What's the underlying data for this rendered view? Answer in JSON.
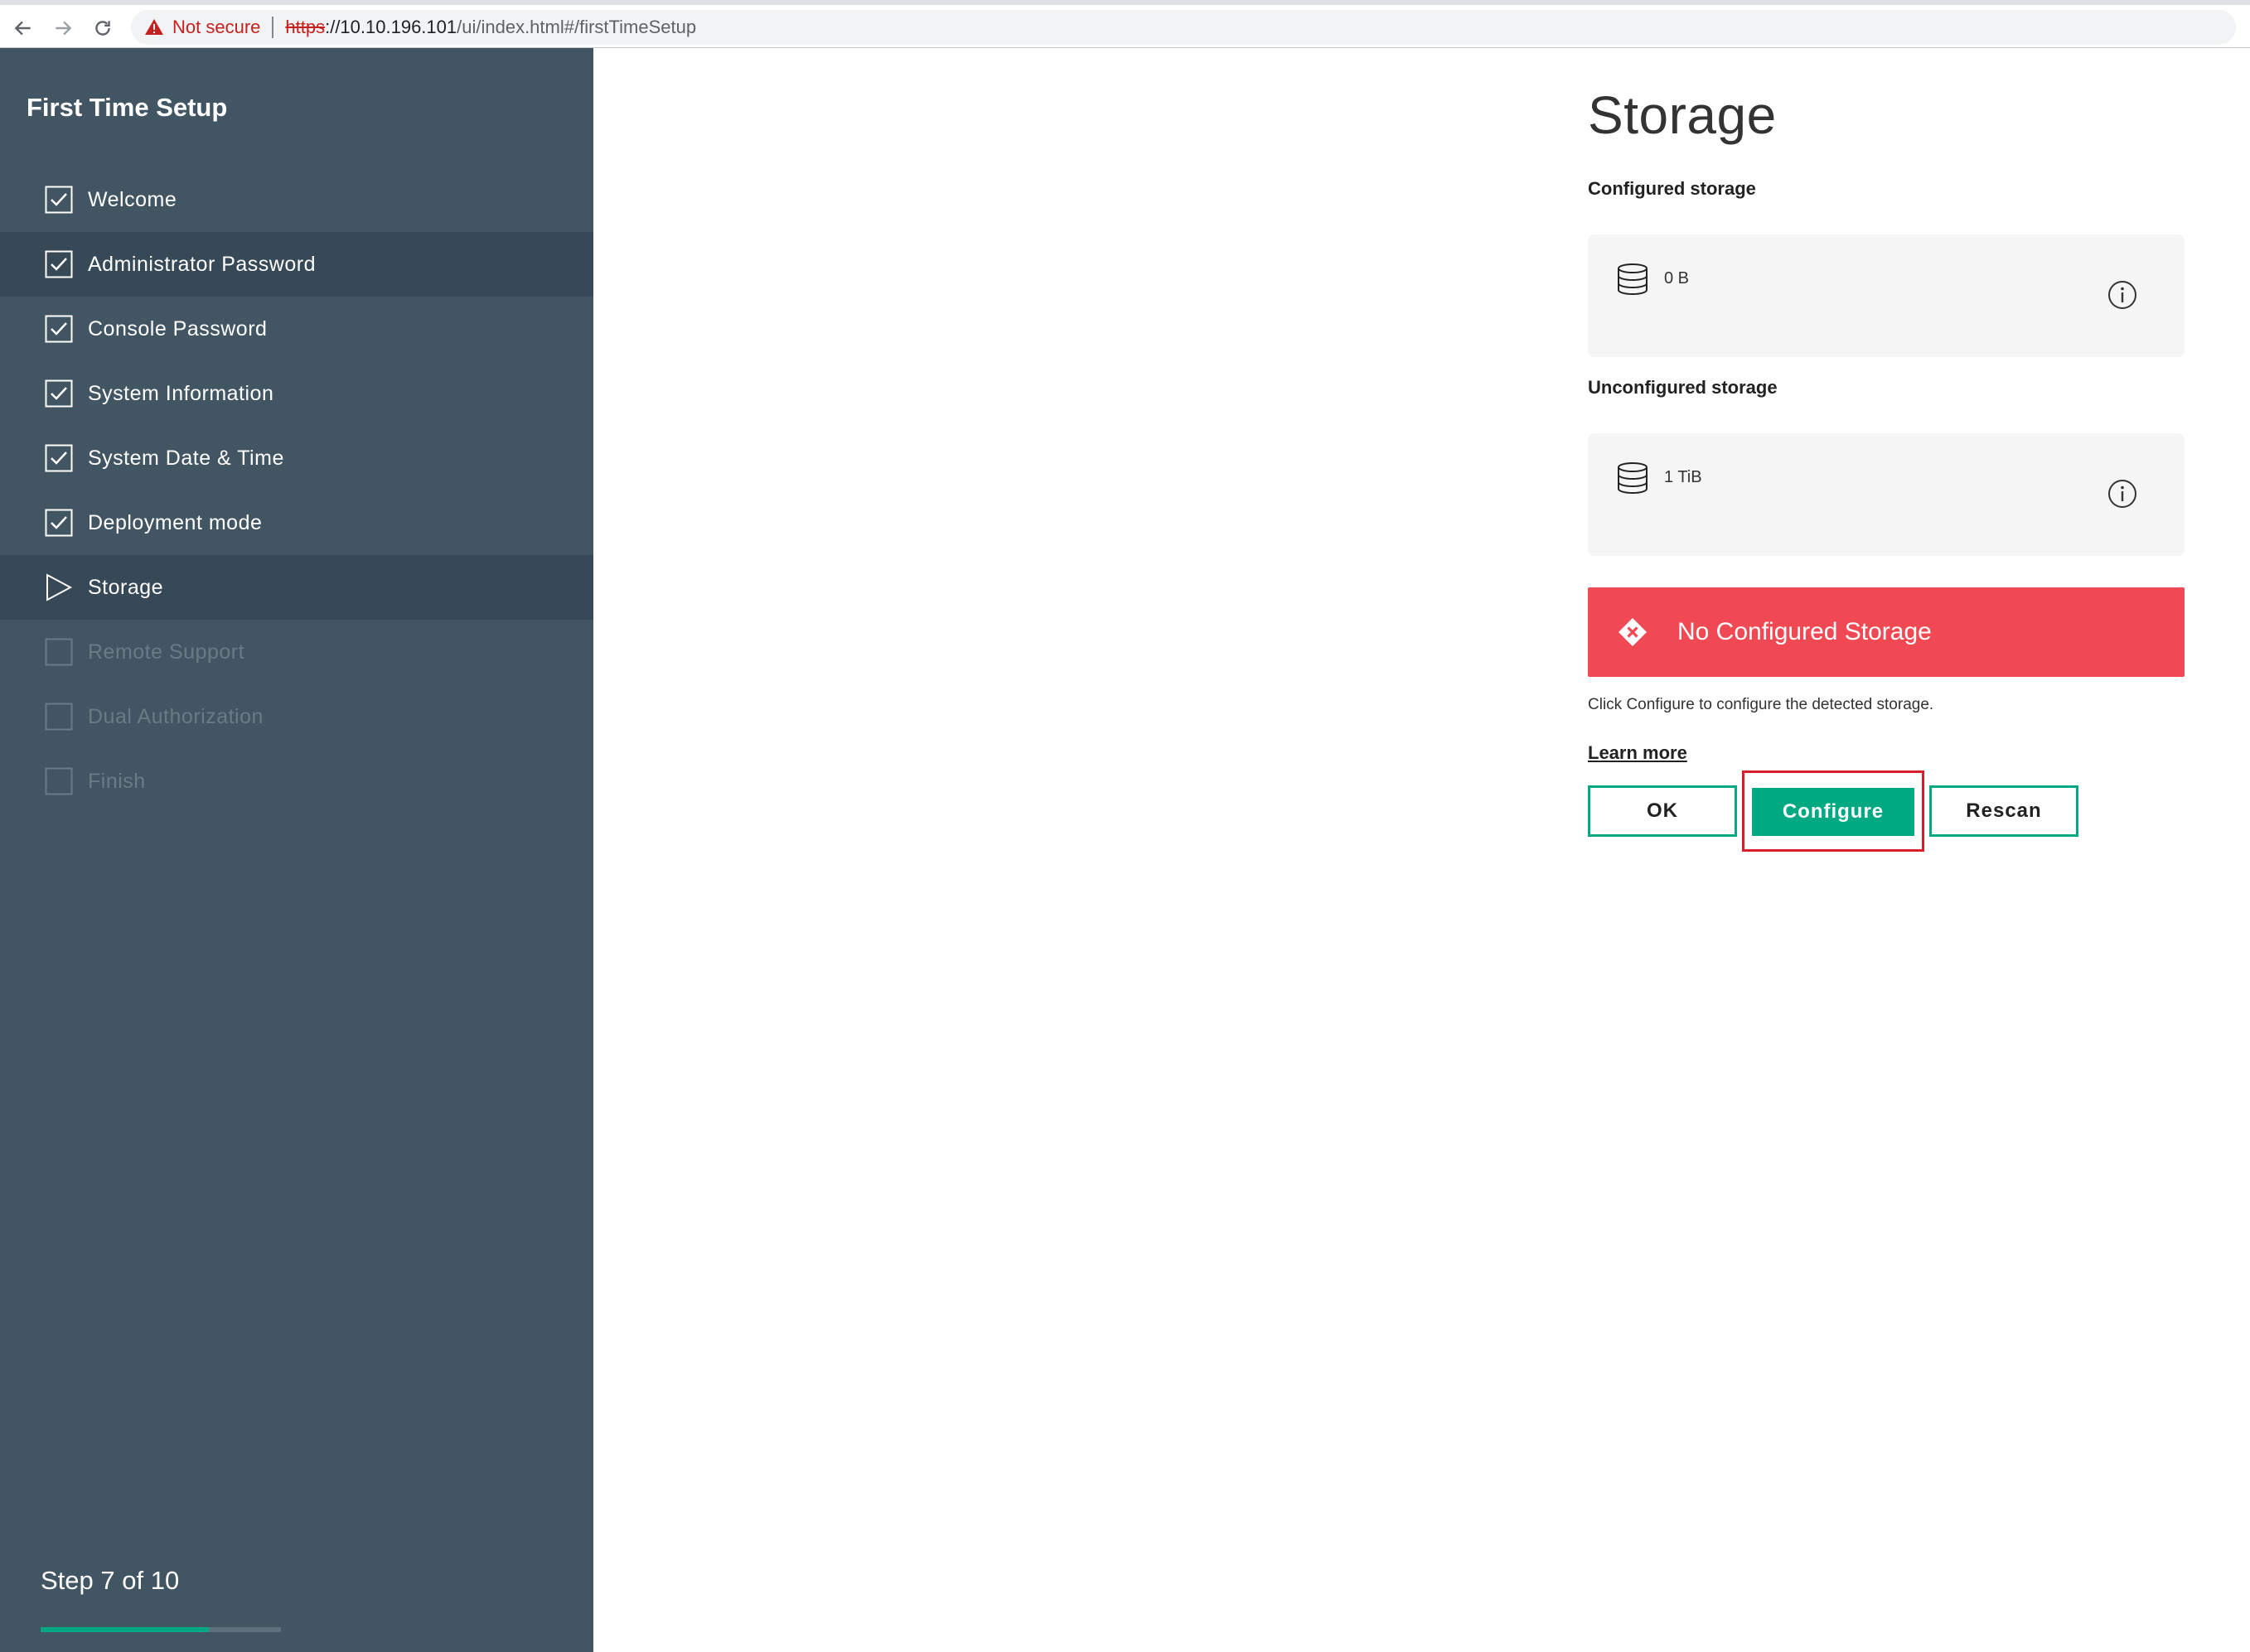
{
  "browser": {
    "security_label": "Not secure",
    "url_scheme": "https",
    "url_host": "://10.10.196.101",
    "url_path": "/ui/index.html#/firstTimeSetup"
  },
  "sidebar": {
    "title": "First Time Setup",
    "steps": [
      {
        "label": "Welcome",
        "status": "done"
      },
      {
        "label": "Administrator Password",
        "status": "done"
      },
      {
        "label": "Console Password",
        "status": "done"
      },
      {
        "label": "System Information",
        "status": "done"
      },
      {
        "label": "System Date & Time",
        "status": "done"
      },
      {
        "label": "Deployment mode",
        "status": "done"
      },
      {
        "label": "Storage",
        "status": "current"
      },
      {
        "label": "Remote Support",
        "status": "pending"
      },
      {
        "label": "Dual Authorization",
        "status": "pending"
      },
      {
        "label": "Finish",
        "status": "pending"
      }
    ],
    "step_counter": "Step 7 of 10",
    "progress_fraction": 0.7
  },
  "main": {
    "title": "Storage",
    "configured_label": "Configured storage",
    "configured_size": "0 B",
    "unconfigured_label": "Unconfigured storage",
    "unconfigured_size": "1 TiB",
    "alert_text": "No Configured Storage",
    "help_text": "Click Configure to configure the detected storage.",
    "learn_more": "Learn more",
    "buttons": {
      "ok": "OK",
      "configure": "Configure",
      "rescan": "Rescan"
    }
  },
  "colors": {
    "sidebar_bg": "#425563",
    "accent": "#01a982",
    "alert": "#f04953",
    "annotation": "#d81e2a"
  }
}
